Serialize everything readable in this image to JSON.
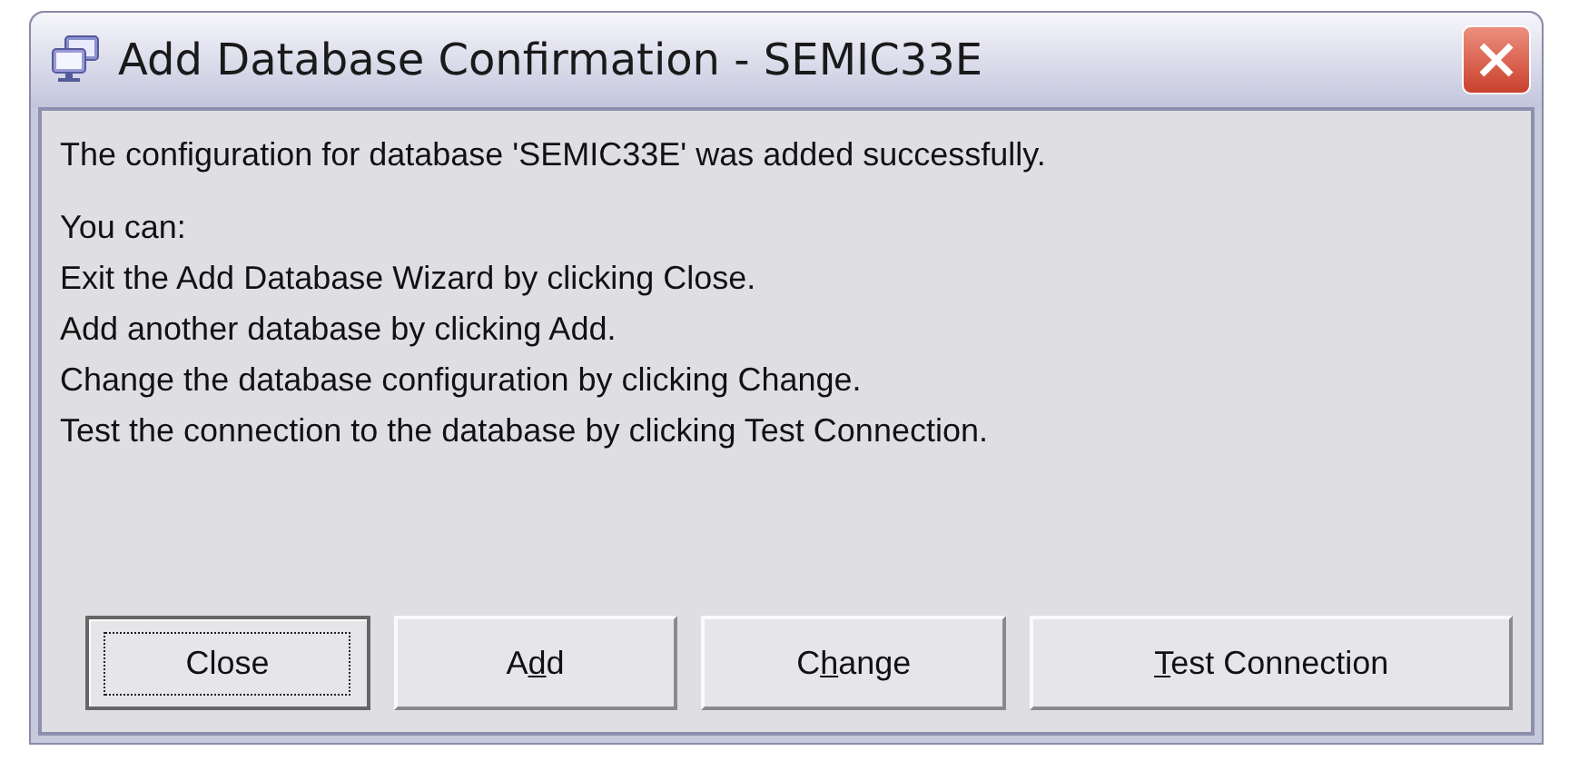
{
  "window": {
    "title": "Add Database Confirmation - SEMIC33E"
  },
  "message": "The configuration for database 'SEMIC33E' was added successfully.",
  "instructions": [
    "You can:",
    "Exit the Add Database Wizard by clicking Close.",
    "Add another database by clicking Add.",
    "Change the database configuration by clicking Change.",
    "Test the connection to the database by clicking Test Connection."
  ],
  "buttons": [
    {
      "pre": "Close",
      "focused": true
    },
    {
      "pre": "A",
      "key": "d",
      "post": "d",
      "focused": false
    },
    {
      "pre": "C",
      "key": "h",
      "post": "ange",
      "focused": false
    },
    {
      "key": "T",
      "post": "est Connection",
      "focused": false
    }
  ]
}
